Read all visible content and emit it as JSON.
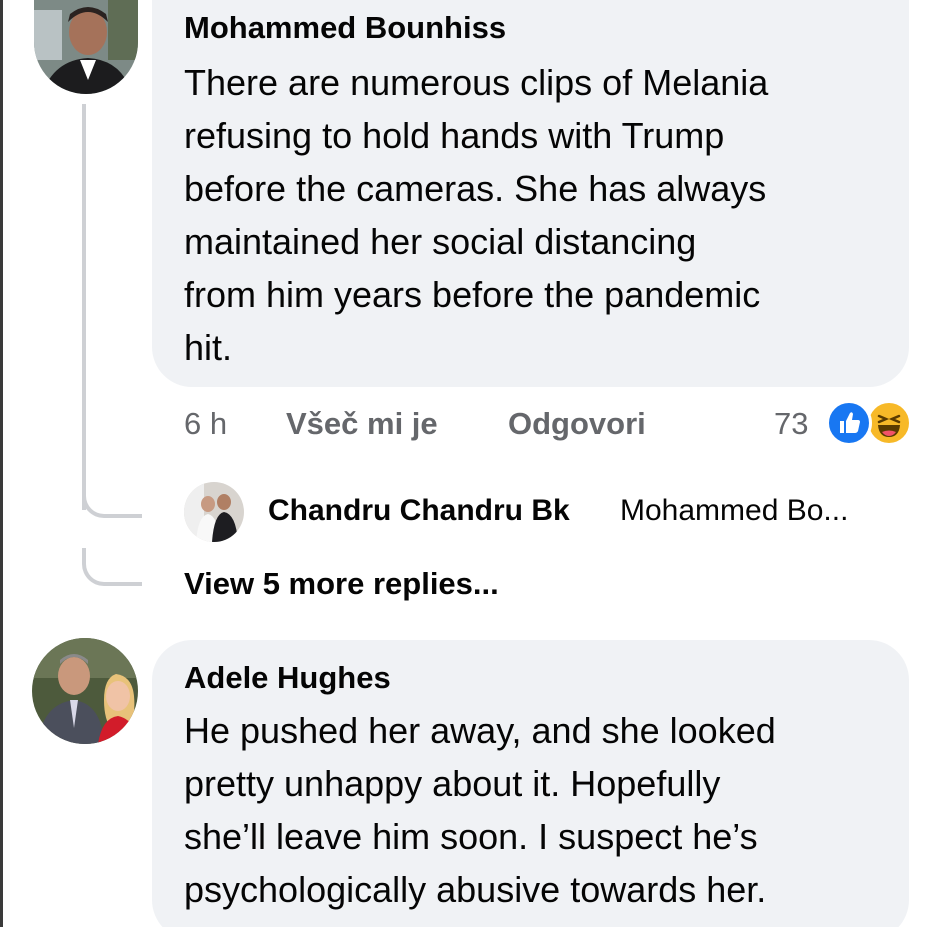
{
  "comments": [
    {
      "author": "Mohammed Bounhiss",
      "text": "There are numerous clips of Melania\nrefusing to hold hands with Trump\nbefore the cameras. She has always\nmaintained her social distancing\nfrom him years before the pandemic\nhit.",
      "time": "6 h",
      "like_label": "Všeč mi je",
      "reply_label": "Odgovori",
      "reaction_count": "73",
      "reactions": [
        "like-reaction-icon",
        "haha-reaction-icon"
      ],
      "reply_preview": {
        "author": "Chandru Chandru Bk",
        "text": "Mohammed Bo..."
      },
      "view_more_label": "View 5 more replies..."
    },
    {
      "author": "Adele Hughes",
      "text": "He pushed her away, and she looked\npretty unhappy about it. Hopefully\nshe’ll leave him soon. I suspect he’s\npsychologically abusive towards her."
    }
  ],
  "colors": {
    "bubble": "#f0f2f5",
    "secondary_text": "#65676b",
    "like_blue": "#1877f2",
    "haha_yellow": "#f7b928",
    "thread_line": "#ced0d4"
  }
}
